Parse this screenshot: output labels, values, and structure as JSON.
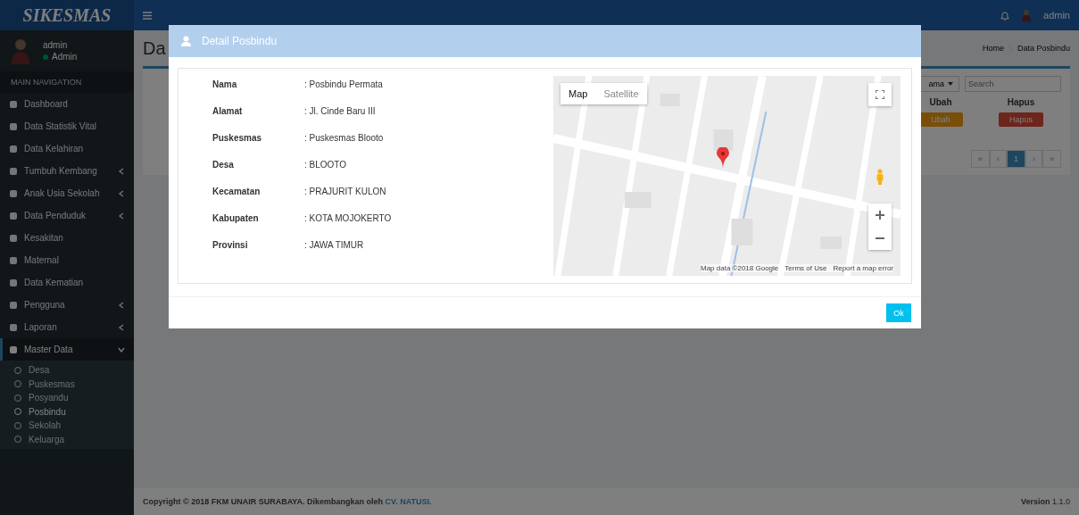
{
  "brand": "SIKESMAS",
  "header": {
    "user": "admin"
  },
  "user_panel": {
    "name": "admin",
    "role": "Admin"
  },
  "sidebar": {
    "header": "MAIN NAVIGATION",
    "items": [
      {
        "label": "Dashboard",
        "expandable": false,
        "selected": false
      },
      {
        "label": "Data Statistik Vital",
        "expandable": false,
        "selected": false
      },
      {
        "label": "Data Kelahiran",
        "expandable": false,
        "selected": false
      },
      {
        "label": "Tumbuh Kembang",
        "expandable": true,
        "expanded": false,
        "selected": false
      },
      {
        "label": "Anak Usia Sekolah",
        "expandable": true,
        "expanded": false,
        "selected": false
      },
      {
        "label": "Data Penduduk",
        "expandable": true,
        "expanded": false,
        "selected": false
      },
      {
        "label": "Kesakitan",
        "expandable": false,
        "selected": false
      },
      {
        "label": "Maternal",
        "expandable": false,
        "selected": false
      },
      {
        "label": "Data Kematian",
        "expandable": false,
        "selected": false
      },
      {
        "label": "Pengguna",
        "expandable": true,
        "expanded": false,
        "selected": false
      },
      {
        "label": "Laporan",
        "expandable": true,
        "expanded": false,
        "selected": false
      },
      {
        "label": "Master Data",
        "expandable": true,
        "expanded": true,
        "selected": true,
        "children": [
          {
            "label": "Desa",
            "selected": false
          },
          {
            "label": "Puskesmas",
            "selected": false
          },
          {
            "label": "Posyandu",
            "selected": false
          },
          {
            "label": "Posbindu",
            "selected": true
          },
          {
            "label": "Sekolah",
            "selected": false
          },
          {
            "label": "Keluarga",
            "selected": false
          }
        ]
      }
    ]
  },
  "content": {
    "title": "Da",
    "breadcrumb": [
      "Home",
      "Data Posbindu"
    ],
    "filter": {
      "select": "ama",
      "placeholder": "Search"
    },
    "table": {
      "columns": [
        "Ubah",
        "Hapus"
      ],
      "rows": [
        {
          "edit": "Ubah",
          "delete": "Hapus"
        }
      ]
    },
    "pagination": [
      {
        "label": "«",
        "selected": false
      },
      {
        "label": "‹",
        "selected": false
      },
      {
        "label": "1",
        "selected": true
      },
      {
        "label": "›",
        "selected": false
      },
      {
        "label": "»",
        "selected": false
      }
    ]
  },
  "footer": {
    "text": "Copyright © 2018 FKM UNAIR SURABAYA. Dikembangkan oleh",
    "link": "CV. NATUSI.",
    "version": "**Version** 1.1.0"
  },
  "modal": {
    "title": "Detail Posbindu",
    "fields": [
      {
        "label": "Nama",
        "value": ": Posbindu Permata"
      },
      {
        "label": "Alamat",
        "value": ": Jl. Cinde Baru III"
      },
      {
        "label": "Puskesmas",
        "value": ": Puskesmas Blooto"
      },
      {
        "label": "Desa",
        "value": ": BLOOTO"
      },
      {
        "label": "Kecamatan",
        "value": ": PRAJURIT KULON"
      },
      {
        "label": "Kabupaten",
        "value": ": KOTA MOJOKERTO"
      },
      {
        "label": "Provinsi",
        "value": ": JAWA TIMUR"
      }
    ],
    "map": {
      "types": [
        {
          "label": "Map",
          "selected": true
        },
        {
          "label": "Satellite",
          "selected": false
        }
      ],
      "attribution": [
        "Map data ©2018 Google",
        "Terms of Use",
        "Report a map error"
      ]
    },
    "button": "Ok"
  }
}
